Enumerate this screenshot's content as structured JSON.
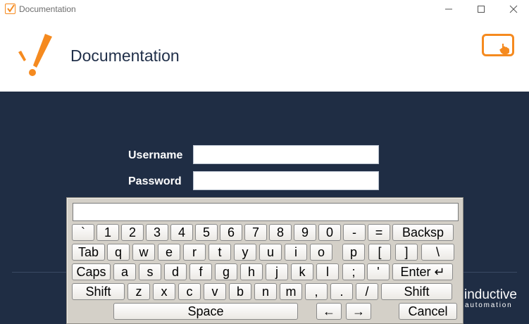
{
  "window": {
    "title": "Documentation",
    "icon": "ignition-app-icon",
    "controls": [
      "minimize-icon",
      "maximize-icon",
      "close-icon"
    ]
  },
  "header": {
    "title": "Documentation",
    "logo": "exclamation-logo",
    "touch_button_icon": "touch-hand-icon"
  },
  "login": {
    "username_label": "Username",
    "password_label": "Password",
    "username_value": "",
    "password_value": ""
  },
  "keyboard": {
    "display_value": "",
    "rows": [
      [
        "`",
        "1",
        "2",
        "3",
        "4",
        "5",
        "6",
        "7",
        "8",
        "9",
        "0",
        "-",
        "=",
        "Backsp"
      ],
      [
        "Tab",
        "q",
        "w",
        "e",
        "r",
        "t",
        "y",
        "u",
        "i",
        "o",
        "p",
        "[",
        "]",
        "\\"
      ],
      [
        "Caps",
        "a",
        "s",
        "d",
        "f",
        "g",
        "h",
        "j",
        "k",
        "l",
        ";",
        "'",
        "Enter ↵"
      ],
      [
        "Shift",
        "z",
        "x",
        "c",
        "v",
        "b",
        "n",
        "m",
        ",",
        ".",
        "/",
        "Shift"
      ],
      [
        "Space",
        "←",
        "→",
        "Cancel"
      ]
    ]
  },
  "brand": {
    "name": "inductive",
    "sub": "automation"
  },
  "colors": {
    "accent": "#f58a1f",
    "navy": "#1f2d44",
    "title_text": "#21304a",
    "keyboard_bg": "#d4d0c8"
  }
}
